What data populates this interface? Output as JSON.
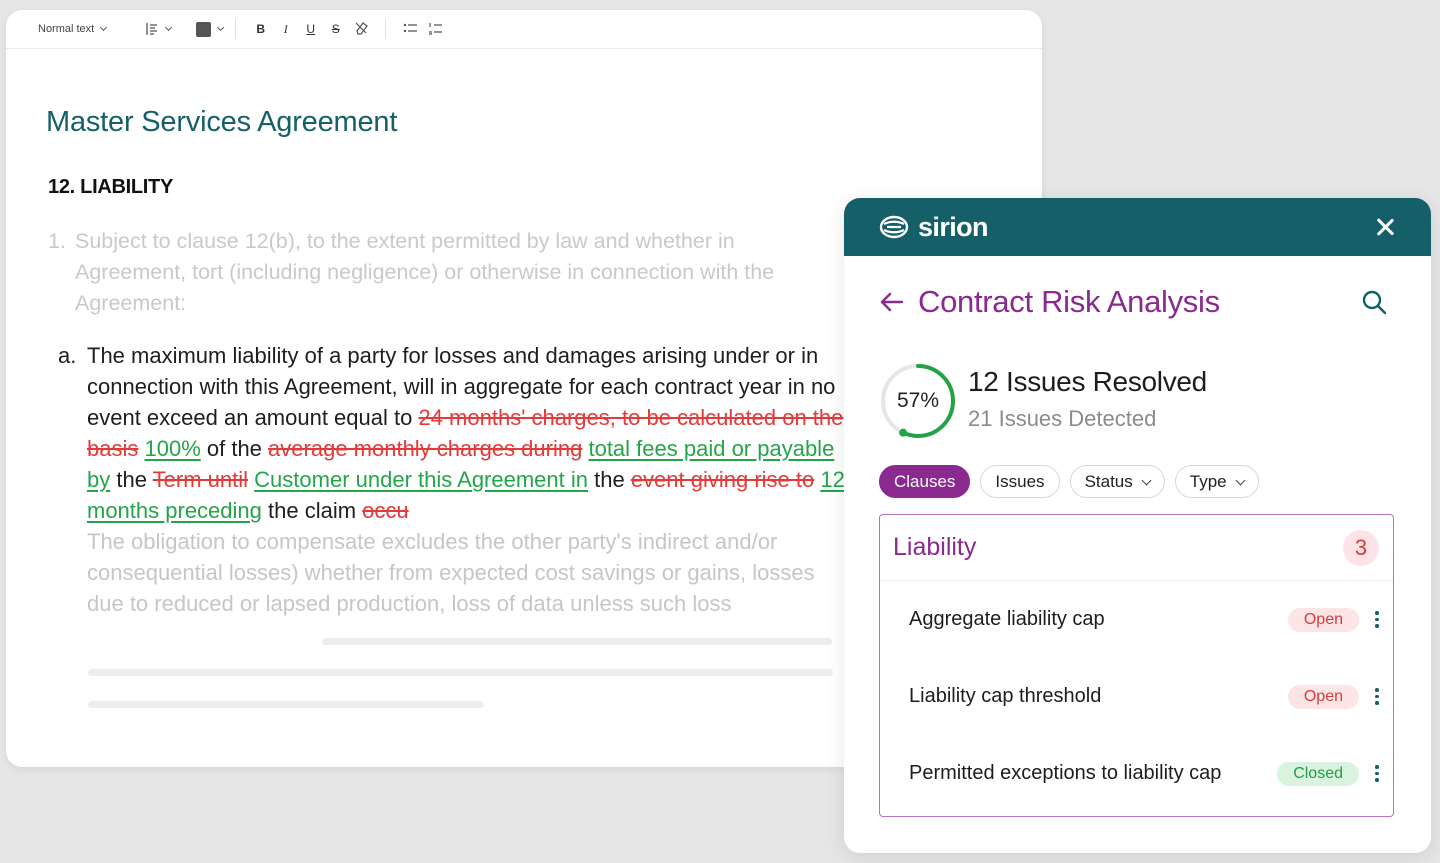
{
  "toolbar": {
    "text_style": "Normal text",
    "align_icon": "align-left-icon",
    "color_icon": "text-color-icon",
    "bold": "B",
    "italic": "I",
    "underline": "U",
    "strike": "S",
    "clear_icon": "clear-format-icon",
    "bullet_icon": "bullet-list-icon",
    "numbered_icon": "numbered-list-icon",
    "swatch_color": "#555555"
  },
  "document": {
    "title": "Master Services Agreement",
    "section": "12. LIABILITY",
    "clause1": {
      "number": "1.",
      "text": "Subject to clause 12(b), to the extent permitted by law and whether in Agreement, tort (including negligence) or otherwise in connection with the Agreement:"
    },
    "clause_a": {
      "number": "a.",
      "t1": "The maximum liability of a party for losses and damages arising under or in connection with this Agreement, will in aggregate for each contract year in no event exceed an amount equal to ",
      "d1": "24 months' charges, to be calculated on the basis",
      "t2": " ",
      "i1": "100%",
      "t3": " of the ",
      "d2": "average monthly charges during",
      "t4": " ",
      "i2": "total fees paid or payable by",
      "t5": " the ",
      "d3": "Term until",
      "t6": " ",
      "i3": "Customer under this Agreement in",
      "t7": " the ",
      "d4": "event giving rise to",
      "t8": " ",
      "i4": "12 months preceding",
      "t9": " the claim ",
      "d5": "occu",
      "faded": "The obligation to compensate excludes the other party's indirect and/or consequential losses) whether from expected cost savings or gains, losses due to reduced or lapsed production, loss of data unless such loss"
    }
  },
  "panel": {
    "brand": "sirion",
    "header_color": "#155f69",
    "accent_color": "#8a2a91",
    "title": "Contract Risk Analysis",
    "progress_percent": 57,
    "progress_label": "57%",
    "resolved": "12 Issues Resolved",
    "detected": "21 Issues Detected",
    "filters": [
      {
        "label": "Clauses",
        "active": true
      },
      {
        "label": "Issues",
        "active": false
      },
      {
        "label": "Status",
        "dropdown": true
      },
      {
        "label": "Type",
        "dropdown": true
      }
    ],
    "group": {
      "title": "Liability",
      "count": "3",
      "items": [
        {
          "label": "Aggregate liability cap",
          "status": "Open"
        },
        {
          "label": "Liability cap threshold",
          "status": "Open"
        },
        {
          "label": "Permitted exceptions to liability cap",
          "status": "Closed"
        }
      ]
    }
  }
}
